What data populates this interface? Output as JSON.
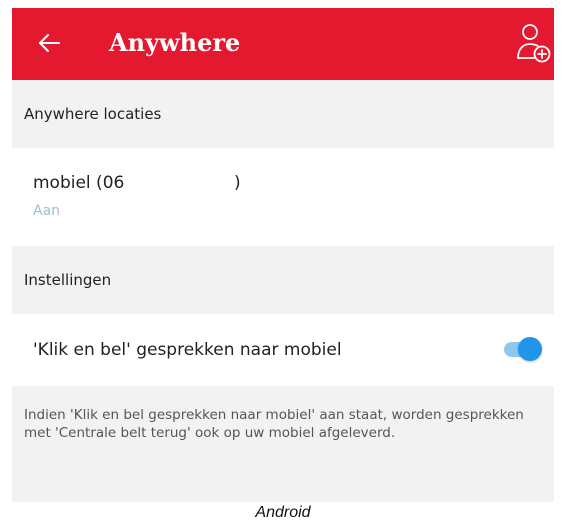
{
  "appbar": {
    "title": "Anywhere",
    "back_icon": "arrow-left-icon",
    "action_icon": "add-user-icon",
    "color": "#e4182f"
  },
  "sections": {
    "locations_header": "Anywhere locaties",
    "settings_header": "Instellingen"
  },
  "location": {
    "name": "mobiel (06",
    "name_close": ")",
    "status": "Aan"
  },
  "setting": {
    "label": "'Klik en bel' gesprekken naar mobiel",
    "enabled": true
  },
  "info": "Indien 'Klik en bel gesprekken naar mobiel' aan staat, worden gesprekken met 'Centrale belt terug' ook op uw mobiel afgeleverd.",
  "caption": "Android"
}
